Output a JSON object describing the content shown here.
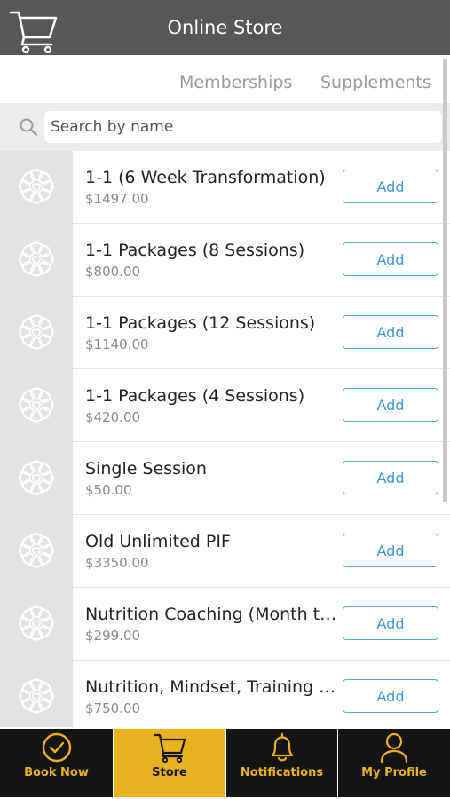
{
  "header": {
    "title": "Online Store",
    "icon": "shopping-cart-icon"
  },
  "tabs": [
    {
      "label": "Memberships"
    },
    {
      "label": "Supplements"
    }
  ],
  "search": {
    "placeholder": "Search by name",
    "value": ""
  },
  "products": [
    {
      "name": "1-1 (6 Week Transformation)",
      "price": "$1497.00",
      "button": "Add"
    },
    {
      "name": "1-1 Packages (8 Sessions)",
      "price": "$800.00",
      "button": "Add"
    },
    {
      "name": "1-1 Packages (12 Sessions)",
      "price": "$1140.00",
      "button": "Add"
    },
    {
      "name": "1-1 Packages (4 Sessions)",
      "price": "$420.00",
      "button": "Add"
    },
    {
      "name": "Single Session",
      "price": "$50.00",
      "button": "Add"
    },
    {
      "name": "Old Unlimited PIF",
      "price": "$3350.00",
      "button": "Add"
    },
    {
      "name": "Nutrition Coaching (Month to Month)",
      "price": "$299.00",
      "button": "Add"
    },
    {
      "name": "Nutrition, Mindset, Training Coaching",
      "price": "$750.00",
      "button": "Add"
    }
  ],
  "bottom_nav": [
    {
      "label": "Book Now",
      "icon": "checkmark-circle-icon",
      "active": false
    },
    {
      "label": "Store",
      "icon": "shopping-cart-icon",
      "active": true
    },
    {
      "label": "Notifications",
      "icon": "bell-icon",
      "active": false
    },
    {
      "label": "My Profile",
      "icon": "user-icon",
      "active": false
    }
  ],
  "colors": {
    "header_bg": "#575757",
    "accent": "#E8B21F",
    "nav_bg": "#141414",
    "button_blue": "#3C97D1",
    "thumb_bg": "#E3E3E3"
  }
}
